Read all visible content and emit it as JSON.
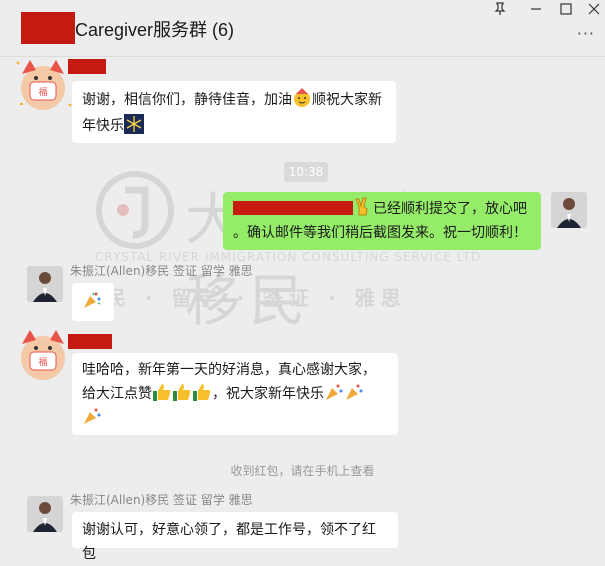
{
  "window": {
    "title": "Caregiver服务群 (6)",
    "pin_icon": "pin-icon",
    "minimize_icon": "minimize-icon",
    "maximize_icon": "maximize-icon",
    "more_icon": "more-icon"
  },
  "watermark": {
    "brand": "大江留学移民",
    "english": "CRYSTAL RIVER IMMIGRATION CONSULTING SERVICE LTD",
    "services": "移民 · 留学 · 签证 · 雅思"
  },
  "messages": [
    {
      "id": "m1",
      "sender": "",
      "side": "left",
      "text_a": "谢谢，相信你们，静待佳音，加油",
      "text_b": "顺祝大家新年快乐",
      "icons": [
        "party-face-icon",
        "fireworks-icon"
      ]
    },
    {
      "id": "ts",
      "timestamp": "10:38"
    },
    {
      "id": "m2",
      "sender": "",
      "side": "right",
      "text_a": "已经顺利提交了，放心吧",
      "text_b": "。确认邮件等我们稍后截图发来。祝一切顺利！",
      "icons": [
        "victory-hand-icon"
      ]
    },
    {
      "id": "m3",
      "sender": "朱振江(Allen)移民 签证 留学 雅思",
      "side": "left",
      "text": "",
      "icons": [
        "party-popper-icon"
      ]
    },
    {
      "id": "m4",
      "sender": "",
      "side": "left",
      "text_a": "哇哈哈，新年第一天的好消息，真心感谢大家，给大江点赞",
      "text_b": "，祝大家新年快乐",
      "icons": [
        "thumbs-up-icon",
        "party-popper-icon"
      ]
    },
    {
      "id": "sys",
      "system": "收到红包，请在手机上查看"
    },
    {
      "id": "m5",
      "sender": "朱振江(Allen)移民 签证 留学 雅思",
      "side": "left",
      "text": "谢谢认可，好意心领了，都是工作号，领不了红包"
    }
  ],
  "colors": {
    "redaction": "#c41a12",
    "bubble_green": "#95ec69",
    "background": "#ededed"
  }
}
